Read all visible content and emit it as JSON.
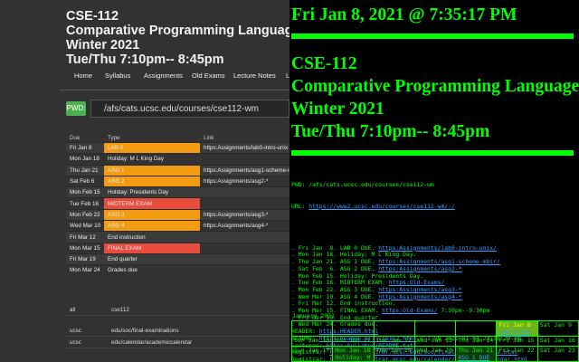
{
  "course": {
    "code": "CSE-112",
    "title": "Comparative Programming Languages",
    "term": "Winter 2021",
    "time": "Tue/Thu 7:10pm-- 8:45pm"
  },
  "nav": [
    "Home",
    "Syllabus",
    "Assignments",
    "Old Exams",
    "Lecture Notes",
    "L"
  ],
  "pwd": {
    "label": "PWD:",
    "path": "/afs/cats.ucsc.edu/courses/cse112-wm"
  },
  "schedule": {
    "headers": [
      "Due",
      "Type",
      "Link"
    ],
    "rows": [
      {
        "date": "Fri Jan 8",
        "type": "LAB 0",
        "link": "https:Assignments/lab0-intro-unix",
        "style": "org"
      },
      {
        "date": "Mon Jan 18",
        "type": "Holiday: M L King Day",
        "link": "",
        "style": ""
      },
      {
        "date": "Thu Jan 21",
        "type": "ASG 1",
        "link": "https:Assignments/asg1-scheme-mb",
        "style": "org"
      },
      {
        "date": "Sat Feb 6",
        "type": "ASG 2",
        "link": "https:Assignments/asg2-*",
        "style": "org"
      },
      {
        "date": "Mon Feb 15",
        "type": "Holiday: Presidents Day",
        "link": "",
        "style": ""
      },
      {
        "date": "Tue Feb 16",
        "type": "MIDTERM EXAM",
        "link": "",
        "style": "redc"
      },
      {
        "date": "Mon Feb 22",
        "type": "ASG 3",
        "link": "https:Assignments/asg3-*",
        "style": "org"
      },
      {
        "date": "Wed Mar 10",
        "type": "ASG 4",
        "link": "https:Assignments/asg4-*",
        "style": "org"
      },
      {
        "date": "Fri Mar 12",
        "type": "End instruction",
        "link": "",
        "style": ""
      },
      {
        "date": "Mon Mar 15",
        "type": "FINAL EXAM",
        "link": "",
        "style": "redc"
      },
      {
        "date": "Fri Mar 19",
        "type": "End quarter",
        "link": "",
        "style": ""
      },
      {
        "date": "Mon Mar 24",
        "type": "Grades due",
        "link": "",
        "style": ""
      }
    ]
  },
  "links": [
    {
      "key": "all",
      "value": "cse112"
    },
    {
      "key": "ucsc",
      "value": "edu/soc/final-examinations"
    },
    {
      "key": "ucsc",
      "value": "edu/calendar/academiccalendar"
    }
  ],
  "right": {
    "datetime": "Fri Jan 8, 2021 @ 7:35:17 PM",
    "pwd_line": "PWD: /afs/cats.ucsc.edu/courses/cse112-wm",
    "url_label": "URL: ",
    "url": "https://www2.ucsc.edu/courses/cse112-wm/:/",
    "lines": [
      {
        "pre": ". Fri Jan  8. LAB 0 DUE. ",
        "link": "https:Assignments/lab0-intro-unix/",
        "post": ""
      },
      {
        "pre": ". Mon Jan 18. Holiday: M L King Day.",
        "link": "",
        "post": ""
      },
      {
        "pre": ". Thu Jan 21. ASG 1 DUE. ",
        "link": "https:Assignments/asg1-scheme-mbir/",
        "post": ""
      },
      {
        "pre": ". Sat Feb  6. ASG 2 DUE. ",
        "link": "https:Assignments/asg2-*",
        "post": ""
      },
      {
        "pre": ". Mon Feb 15. Holiday: Presidents Day.",
        "link": "",
        "post": ""
      },
      {
        "pre": ". Tue Feb 16. MIDTERM EXAM. ",
        "link": "https:Old-Exams/",
        "post": ""
      },
      {
        "pre": ". Mon Feb 22. ASG 3 DUE. ",
        "link": "https:Assignments/asg3-*",
        "post": ""
      },
      {
        "pre": ". Wed Mar 10. ASG 4 DUE. ",
        "link": "https:Assignments/asg4-*",
        "post": ""
      },
      {
        "pre": ". Fri Mar 12. End instruction.",
        "link": "",
        "post": ""
      },
      {
        "pre": ". Mon Mar 15. FINAL EXAM. ",
        "link": "https:Old-Exams/",
        "post": " 7:30pm--9:30pm"
      },
      {
        "pre": ". Fri Mar 19. End quarter.",
        "link": "",
        "post": ""
      },
      {
        "pre": ". Wed Mar 24. Grades due.",
        "link": "",
        "post": ""
      },
      {
        "pre": "HEADER: ",
        "link": "https:HEADER.html",
        "post": ""
      },
      {
        "pre": "README: ",
        "link": "https:Readme.all.cse112.html",
        "post": ",v 1.58 2021-01-04 23:36:29-08"
      },
      {
        "pre": "Lectures: ",
        "link": "https:Syllabus/README.txt",
        "post": ""
      },
      {
        "pre": "Registrar: ",
        "link": "https://registrar.ucsc.edu/soc/final-examinations.html",
        "post": ""
      },
      {
        "pre": "Registrar: ",
        "link": "https://registrar.ucsc.edu/calendar/academiccalendar.html",
        "post": ""
      }
    ],
    "calendar_title": "January 2021",
    "cal_row1": [
      "",
      "",
      "",
      "",
      "",
      "Fri Jan  8",
      "Sat Jan  9"
    ],
    "cal_row1_event": "LAB 0 DUE",
    "cal_row2": [
      "Sun Jan 10",
      "Mon Jan 11",
      "Tue Jan 12",
      "Wed Jan 13",
      "Thu Jan 14",
      "Fri Jan 15",
      "Sat Jan 16"
    ],
    "cal_row3": [
      "Sun Jan 17",
      "Mon Jan 18",
      "Tue Jan 19",
      "Wed Jan 20",
      "Thu Jan 21",
      "Fri Jan 22",
      "Sat Jan 23"
    ],
    "cal_row3_holiday": "Holiday: M",
    "cal_row3_event": "ASG 1 DUE"
  }
}
